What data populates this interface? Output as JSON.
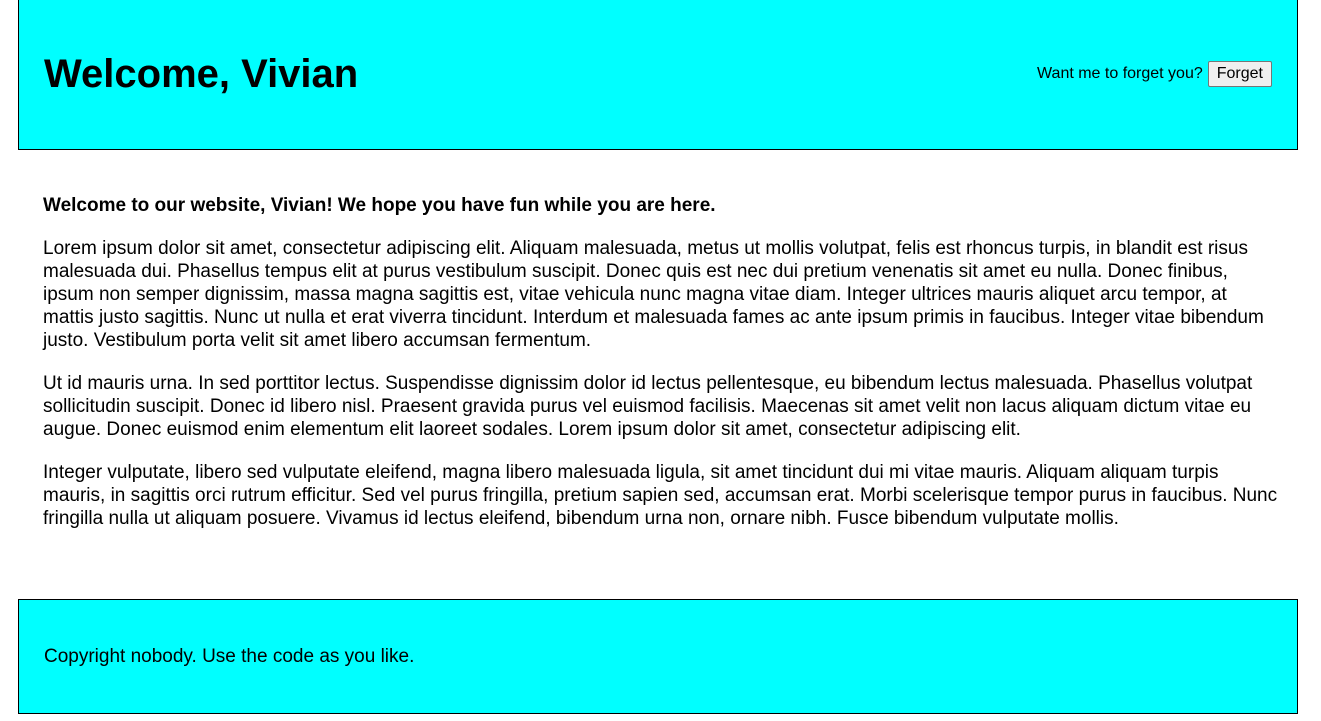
{
  "header": {
    "title": "Welcome, Vivian",
    "forget_prompt": "Want me to forget you?",
    "forget_button_label": "Forget",
    "background_color": "#00ffff"
  },
  "main": {
    "intro": "Welcome to our website, Vivian! We hope you have fun while you are here.",
    "paragraphs": [
      "Lorem ipsum dolor sit amet, consectetur adipiscing elit. Aliquam malesuada, metus ut mollis volutpat, felis est rhoncus turpis, in blandit est risus malesuada dui. Phasellus tempus elit at purus vestibulum suscipit. Donec quis est nec dui pretium venenatis sit amet eu nulla. Donec finibus, ipsum non semper dignissim, massa magna sagittis est, vitae vehicula nunc magna vitae diam. Integer ultrices mauris aliquet arcu tempor, at mattis justo sagittis. Nunc ut nulla et erat viverra tincidunt. Interdum et malesuada fames ac ante ipsum primis in faucibus. Integer vitae bibendum justo. Vestibulum porta velit sit amet libero accumsan fermentum.",
      "Ut id mauris urna. In sed porttitor lectus. Suspendisse dignissim dolor id lectus pellentesque, eu bibendum lectus malesuada. Phasellus volutpat sollicitudin suscipit. Donec id libero nisl. Praesent gravida purus vel euismod facilisis. Maecenas sit amet velit non lacus aliquam dictum vitae eu augue. Donec euismod enim elementum elit laoreet sodales. Lorem ipsum dolor sit amet, consectetur adipiscing elit.",
      "Integer vulputate, libero sed vulputate eleifend, magna libero malesuada ligula, sit amet tincidunt dui mi vitae mauris. Aliquam aliquam turpis mauris, in sagittis orci rutrum efficitur. Sed vel purus fringilla, pretium sapien sed, accumsan erat. Morbi scelerisque tempor purus in faucibus. Nunc fringilla nulla ut aliquam posuere. Vivamus id lectus eleifend, bibendum urna non, ornare nibh. Fusce bibendum vulputate mollis."
    ]
  },
  "footer": {
    "text": "Copyright nobody. Use the code as you like.",
    "background_color": "#00ffff"
  }
}
